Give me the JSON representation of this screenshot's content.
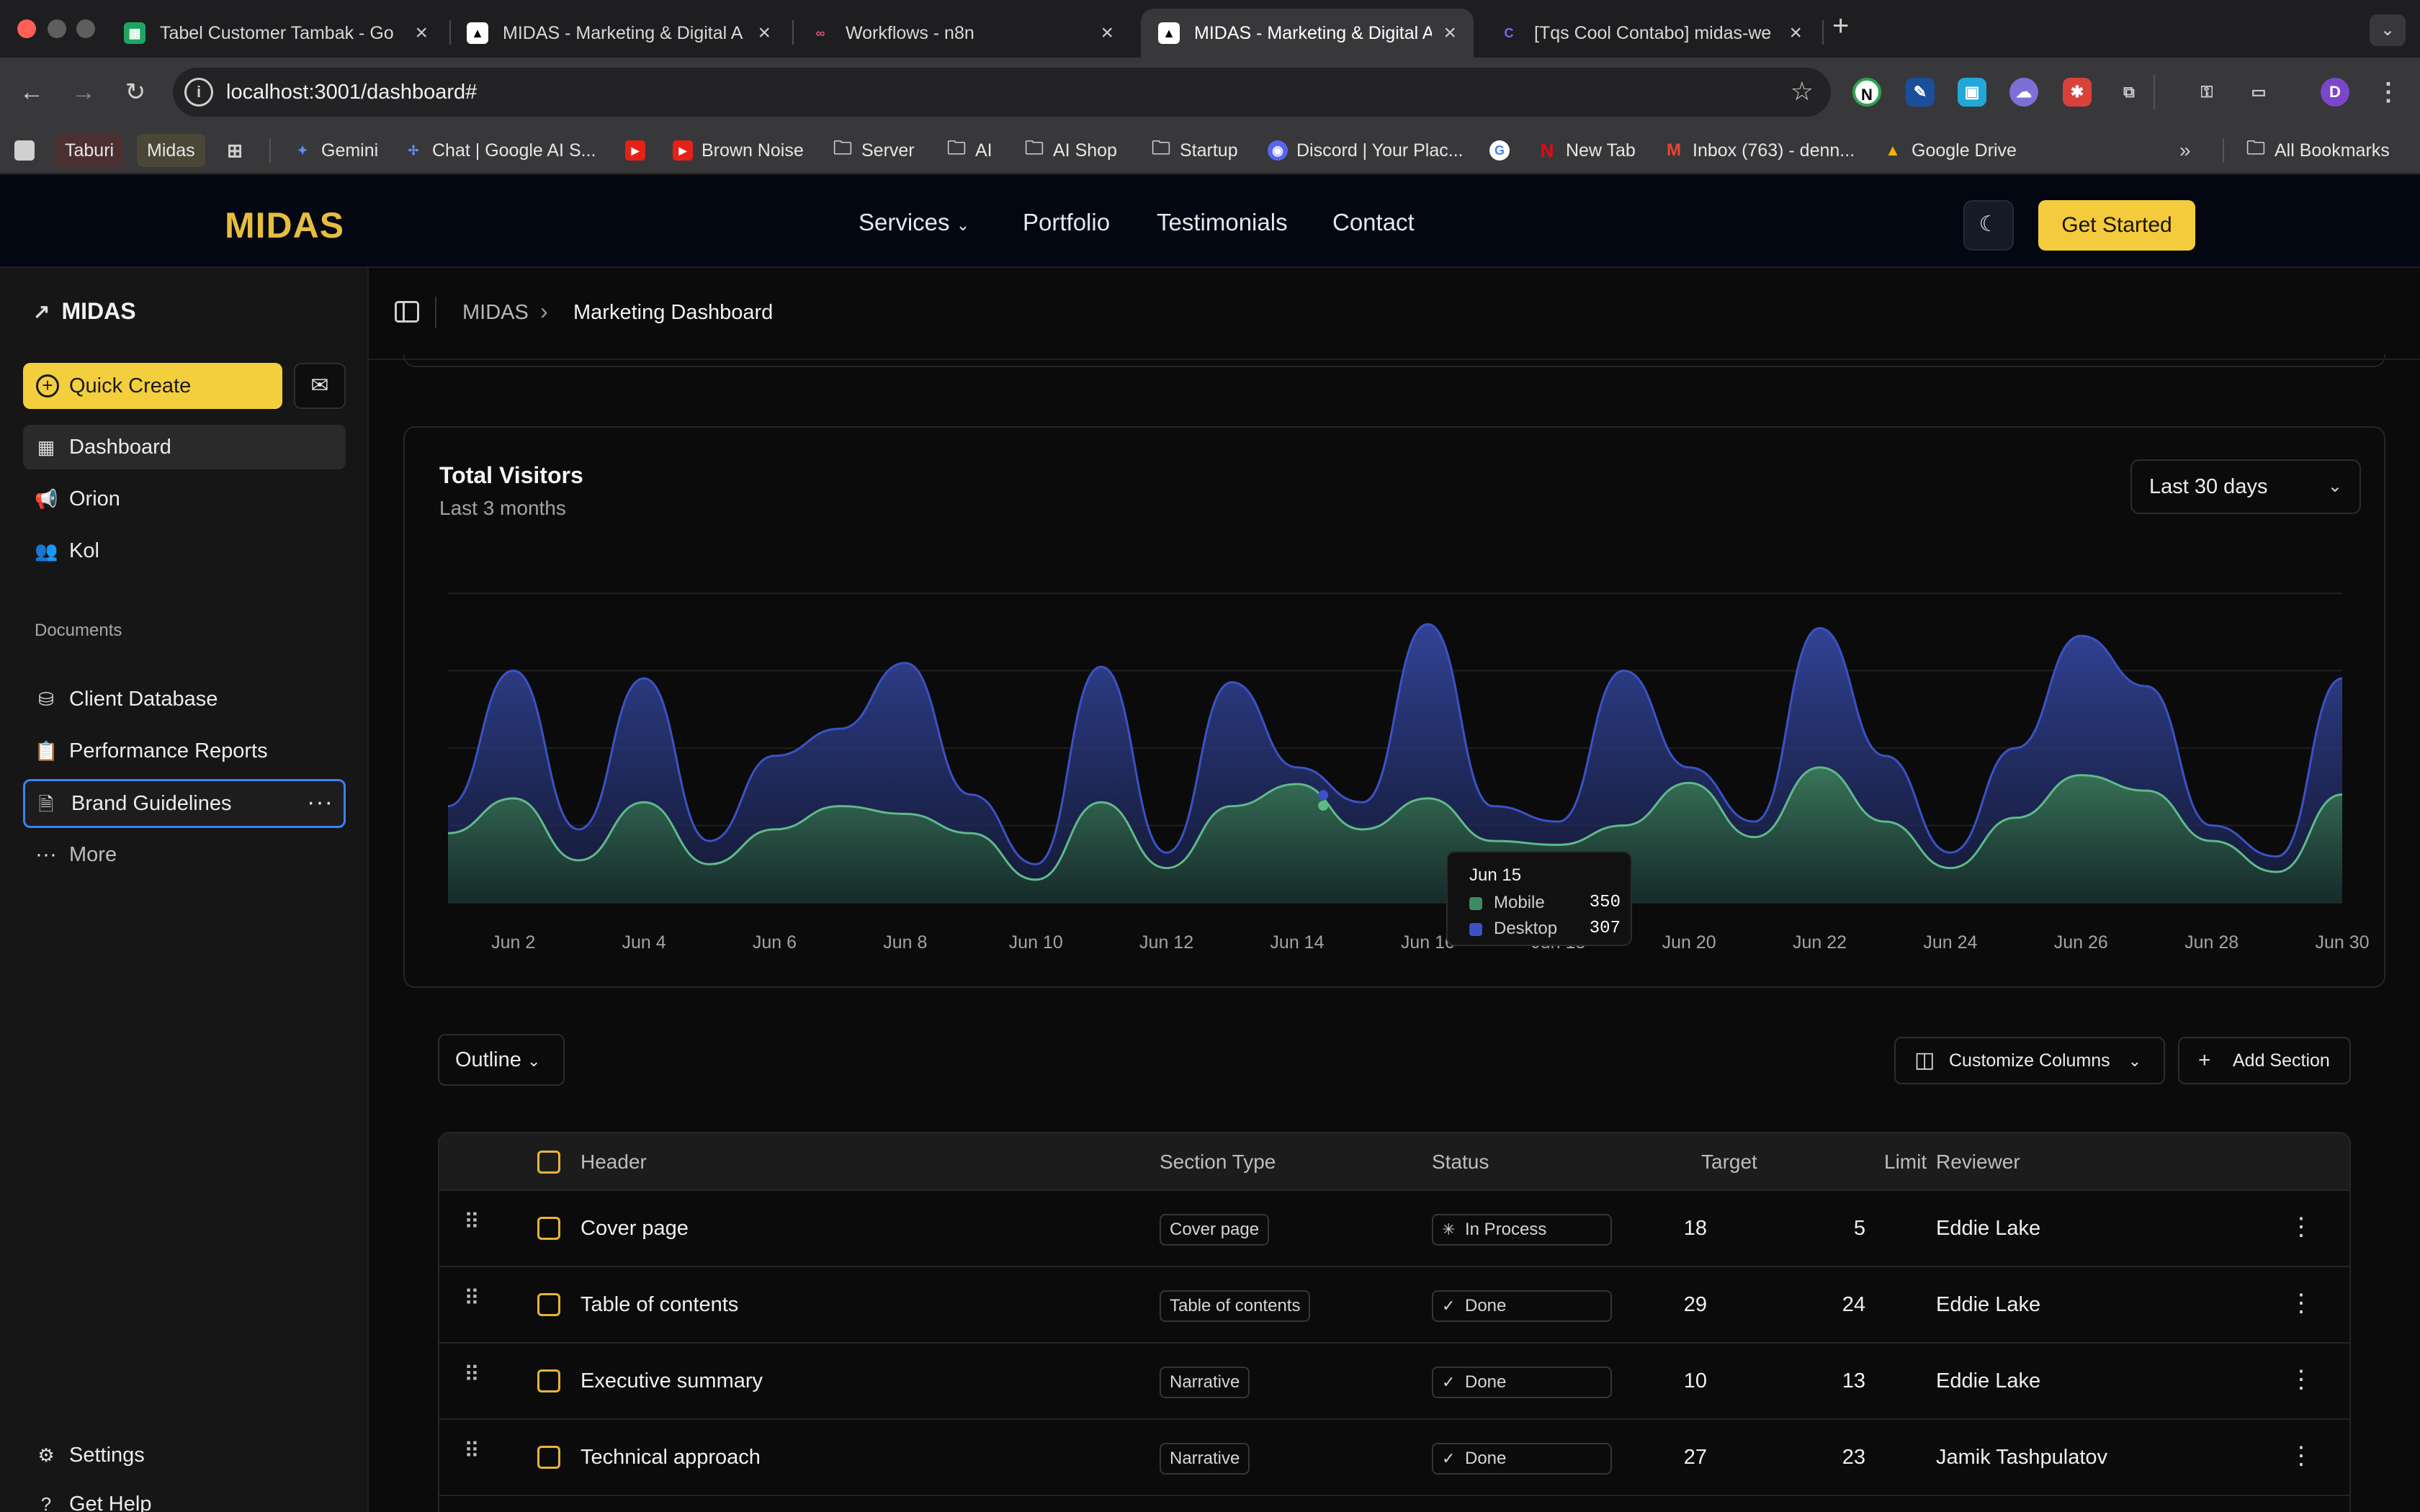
{
  "browser": {
    "tabs": [
      {
        "title": "Tabel Customer Tambak - Go",
        "favicon": "sheets-icon",
        "active": false
      },
      {
        "title": "MIDAS - Marketing & Digital A",
        "favicon": "midas-icon",
        "active": false
      },
      {
        "title": "Workflows - n8n",
        "favicon": "n8n-icon",
        "active": false
      },
      {
        "title": "MIDAS - Marketing & Digital A",
        "favicon": "midas-icon",
        "active": true
      },
      {
        "title": "[Tqs Cool Contabo] midas-we",
        "favicon": "coolify-icon",
        "active": false
      }
    ],
    "new_tab": "+",
    "url": "localhost:3001/dashboard#",
    "profile_initial": "D",
    "bookmarks": [
      "Taburi",
      "Midas",
      "Gemini",
      "Chat | Google AI S...",
      "Brown Noise",
      "Server",
      "AI",
      "AI Shop",
      "Startup",
      "Discord | Your Plac...",
      "New Tab",
      "Inbox (763) - denn...",
      "Google Drive"
    ],
    "all_bookmarks": "All Bookmarks"
  },
  "header": {
    "logo": "MIDAS",
    "nav": [
      "Services",
      "Portfolio",
      "Testimonials",
      "Contact"
    ],
    "cta": "Get Started",
    "accent": "#f3cb3c"
  },
  "sidebar": {
    "brand": "MIDAS",
    "quick_create": "Quick Create",
    "items": [
      {
        "label": "Dashboard",
        "icon": "dashboard-icon",
        "active": true
      },
      {
        "label": "Orion",
        "icon": "megaphone-icon"
      },
      {
        "label": "Kol",
        "icon": "users-icon"
      }
    ],
    "documents_header": "Documents",
    "documents": [
      {
        "label": "Client Database",
        "icon": "database-icon"
      },
      {
        "label": "Performance Reports",
        "icon": "clipboard-icon"
      },
      {
        "label": "Brand Guidelines",
        "icon": "file-icon",
        "focused": true
      }
    ],
    "more": "More",
    "settings": "Settings",
    "help": "Get Help"
  },
  "breadcrumb": {
    "root": "MIDAS",
    "current": "Marketing Dashboard"
  },
  "chart_card": {
    "title": "Total Visitors",
    "subtitle": "Last 3 months",
    "range": "Last 30 days",
    "tooltip": {
      "date": "Jun 15",
      "mobile_label": "Mobile",
      "mobile_value": "350",
      "desktop_label": "Desktop",
      "desktop_value": "307"
    }
  },
  "chart_data": {
    "type": "area",
    "x": [
      "Jun 1",
      "Jun 2",
      "Jun 3",
      "Jun 4",
      "Jun 5",
      "Jun 6",
      "Jun 7",
      "Jun 8",
      "Jun 9",
      "Jun 10",
      "Jun 11",
      "Jun 12",
      "Jun 13",
      "Jun 14",
      "Jun 15",
      "Jun 16",
      "Jun 17",
      "Jun 18",
      "Jun 19",
      "Jun 20",
      "Jun 21",
      "Jun 22",
      "Jun 23",
      "Jun 24",
      "Jun 25",
      "Jun 26",
      "Jun 27",
      "Jun 28",
      "Jun 29",
      "Jun 30"
    ],
    "tick_labels": [
      "Jun 2",
      "Jun 4",
      "Jun 6",
      "Jun 8",
      "Jun 10",
      "Jun 12",
      "Jun 14",
      "Jun 16",
      "Jun 18",
      "Jun 20",
      "Jun 22",
      "Jun 24",
      "Jun 26",
      "Jun 28",
      "Jun 30"
    ],
    "series": [
      {
        "name": "Mobile",
        "color": "#3b52c4",
        "values": [
          250,
          600,
          190,
          580,
          160,
          380,
          450,
          620,
          280,
          90,
          610,
          120,
          570,
          350,
          260,
          720,
          250,
          210,
          600,
          330,
          120,
          710,
          380,
          100,
          400,
          690,
          560,
          190,
          110,
          580
        ]
      },
      {
        "name": "Desktop",
        "color": "#3f8a62",
        "values": [
          180,
          270,
          110,
          260,
          100,
          190,
          250,
          230,
          180,
          60,
          260,
          90,
          250,
          307,
          190,
          270,
          160,
          150,
          200,
          310,
          170,
          350,
          210,
          90,
          220,
          330,
          290,
          160,
          80,
          280
        ]
      }
    ],
    "stacked": true,
    "ylim": [
      0,
      800
    ],
    "grid": true,
    "legend": "none"
  },
  "toolbar": {
    "outline": "Outline",
    "customize": "Customize Columns",
    "add_section": "Add Section"
  },
  "table": {
    "headers": {
      "header": "Header",
      "type": "Section Type",
      "status": "Status",
      "target": "Target",
      "limit": "Limit",
      "reviewer": "Reviewer"
    },
    "rows": [
      {
        "header": "Cover page",
        "type": "Cover page",
        "status": "In Process",
        "target": "18",
        "limit": "5",
        "reviewer": "Eddie Lake"
      },
      {
        "header": "Table of contents",
        "type": "Table of contents",
        "status": "Done",
        "target": "29",
        "limit": "24",
        "reviewer": "Eddie Lake"
      },
      {
        "header": "Executive summary",
        "type": "Narrative",
        "status": "Done",
        "target": "10",
        "limit": "13",
        "reviewer": "Eddie Lake"
      },
      {
        "header": "Technical approach",
        "type": "Narrative",
        "status": "Done",
        "target": "27",
        "limit": "23",
        "reviewer": "Jamik Tashpulatov"
      }
    ]
  }
}
